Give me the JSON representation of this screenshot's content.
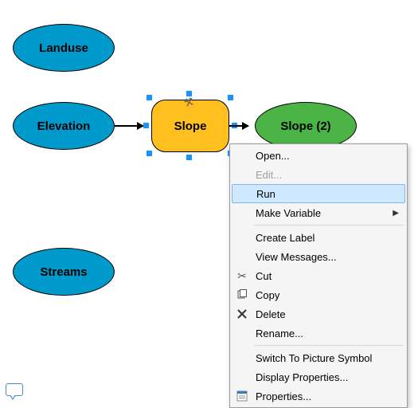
{
  "nodes": {
    "landuse": {
      "label": "Landuse",
      "type": "data-input"
    },
    "elevation": {
      "label": "Elevation",
      "type": "data-input"
    },
    "streams": {
      "label": "Streams",
      "type": "data-input"
    },
    "slope_tool": {
      "label": "Slope",
      "type": "tool",
      "selected": true
    },
    "slope_output": {
      "label": "Slope (2)",
      "type": "data-output"
    }
  },
  "connectors": [
    {
      "from": "elevation",
      "to": "slope_tool"
    },
    {
      "from": "slope_tool",
      "to": "slope_output"
    }
  ],
  "context_menu": {
    "highlighted": "run",
    "items": [
      {
        "id": "open",
        "label": "Open...",
        "enabled": true,
        "icon": null,
        "submenu": false
      },
      {
        "id": "edit",
        "label": "Edit...",
        "enabled": false,
        "icon": null,
        "submenu": false
      },
      {
        "id": "run",
        "label": "Run",
        "enabled": true,
        "icon": null,
        "submenu": false
      },
      {
        "id": "make_var",
        "label": "Make Variable",
        "enabled": true,
        "icon": null,
        "submenu": true
      },
      {
        "sep": true
      },
      {
        "id": "create_label",
        "label": "Create Label",
        "enabled": true,
        "icon": null,
        "submenu": false
      },
      {
        "id": "view_messages",
        "label": "View Messages...",
        "enabled": true,
        "icon": null,
        "submenu": false
      },
      {
        "id": "cut",
        "label": "Cut",
        "enabled": true,
        "icon": "scissors",
        "submenu": false
      },
      {
        "id": "copy",
        "label": "Copy",
        "enabled": true,
        "icon": "copy",
        "submenu": false
      },
      {
        "id": "delete",
        "label": "Delete",
        "enabled": true,
        "icon": "delete",
        "submenu": false
      },
      {
        "id": "rename",
        "label": "Rename...",
        "enabled": true,
        "icon": null,
        "submenu": false
      },
      {
        "sep": true
      },
      {
        "id": "switch_pic",
        "label": "Switch To Picture Symbol",
        "enabled": true,
        "icon": null,
        "submenu": false
      },
      {
        "id": "disp_props",
        "label": "Display Properties...",
        "enabled": true,
        "icon": null,
        "submenu": false
      },
      {
        "id": "properties",
        "label": "Properties...",
        "enabled": true,
        "icon": "props",
        "submenu": false
      }
    ]
  },
  "colors": {
    "data_node": "#0099cc",
    "tool_node": "#ffbf1f",
    "output_node": "#4bb446",
    "selection_handle": "#1a93ff",
    "menu_highlight_bg": "#cde8ff",
    "menu_highlight_border": "#7fb8e9"
  }
}
